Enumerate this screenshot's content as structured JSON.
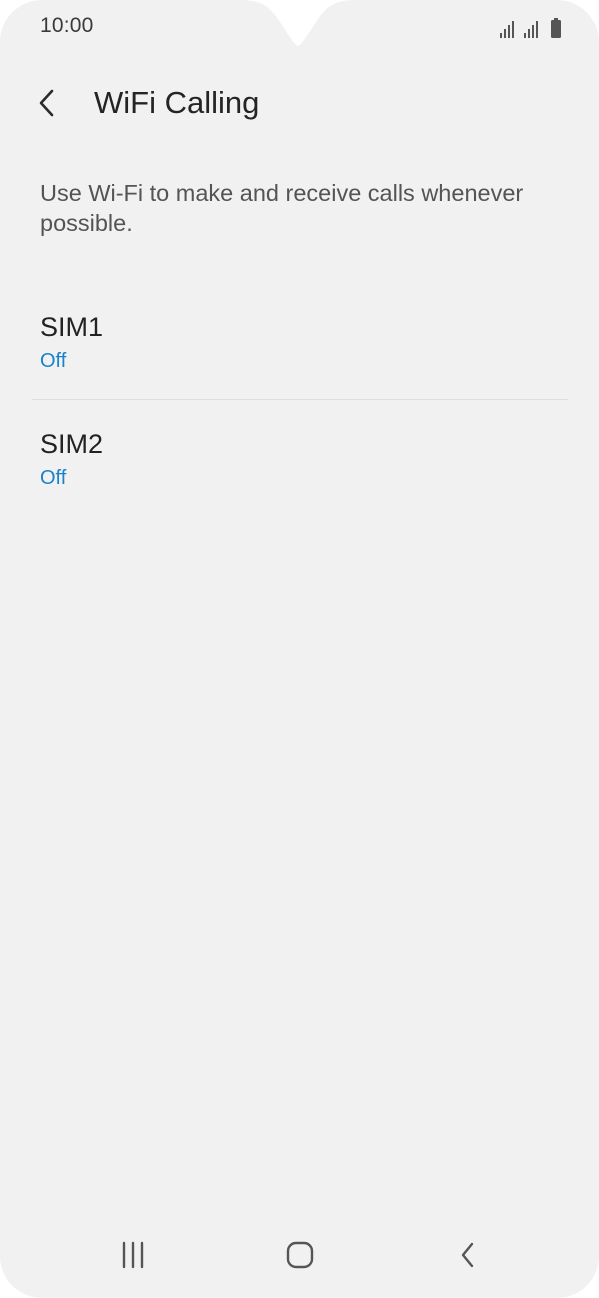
{
  "status_bar": {
    "time": "10:00",
    "icons": [
      "signal-sim1-icon",
      "signal-sim2-icon",
      "battery-icon"
    ]
  },
  "app_bar": {
    "title": "WiFi Calling",
    "back_icon": "chevron-left-icon"
  },
  "description": "Use Wi-Fi to make and receive calls whenever possible.",
  "sims": [
    {
      "label": "SIM1",
      "status": "Off"
    },
    {
      "label": "SIM2",
      "status": "Off"
    }
  ],
  "colors": {
    "background": "#f1f1f1",
    "status_accent": "#1a82c9",
    "text_primary": "#222222",
    "text_secondary": "#545454"
  },
  "nav_bar": {
    "icons": [
      "recent-apps-icon",
      "home-icon",
      "back-icon"
    ]
  }
}
